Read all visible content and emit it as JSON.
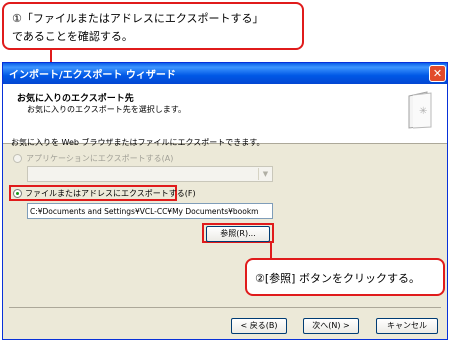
{
  "callout_top": {
    "line1": "①「ファイルまたはアドレスにエクスポートする」",
    "line2": "であることを確認する。"
  },
  "callout_bottom": {
    "text": "②[参照] ボタンをクリックする。"
  },
  "window": {
    "title": "インポート/エクスポート ウィザード",
    "close": "✕"
  },
  "header": {
    "title": "お気に入りのエクスポート先",
    "subtitle": "お気に入りのエクスポート先を選択します。"
  },
  "body": {
    "description": "お気に入りを Web ブラウザまたはファイルにエクスポートできます。",
    "option_app": "アプリケーションにエクスポートする(A)",
    "option_file": "ファイルまたはアドレスにエクスポートする(F)",
    "path_value": "C:¥Documents and Settings¥VCL-CC¥My Documents¥bookm",
    "browse_label": "参照(R)..."
  },
  "footer": {
    "back": "< 戻る(B)",
    "next": "次へ(N) >",
    "cancel": "キャンセル"
  },
  "colors": {
    "highlight": "#e01b1b",
    "titlebar": "#0058e6",
    "dialog_bg": "#ece9d8"
  }
}
